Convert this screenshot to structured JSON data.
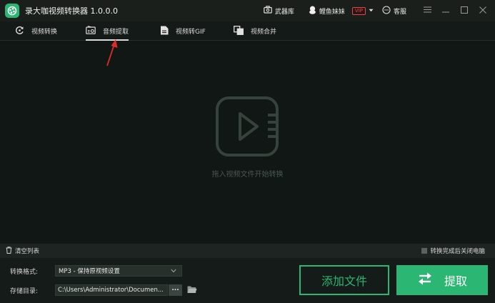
{
  "app": {
    "title": "录大咖视频转换器 1.0.0.0"
  },
  "titlebar": {
    "toolbox_label": "武器库",
    "user_name": "鲤鱼妹妹",
    "vip_badge": "VIP",
    "service_label": "客服"
  },
  "tabs": [
    {
      "label": "视频转换",
      "icon": "refresh-icon"
    },
    {
      "label": "音频提取",
      "icon": "audio-extract-icon",
      "active": true
    },
    {
      "label": "视频转GIF",
      "icon": "file-gif-icon"
    },
    {
      "label": "视频合并",
      "icon": "merge-icon"
    }
  ],
  "main": {
    "drop_hint": "拖入视频文件开始转换"
  },
  "list_bar": {
    "clear_label": "清空列表",
    "shutdown_label": "转换完成后关闭电脑",
    "shutdown_checked": false
  },
  "bottom": {
    "format_label": "转换格式:",
    "format_value": "MP3 - 保持原视频设置",
    "dir_label": "存储目录:",
    "dir_value": "C:\\Users\\Administrator\\Documen...",
    "browse_label": "...",
    "add_button": "添加文件",
    "extract_button": "提取"
  },
  "colors": {
    "accent": "#2bb673",
    "vip": "#e24848",
    "background": "#111714"
  }
}
